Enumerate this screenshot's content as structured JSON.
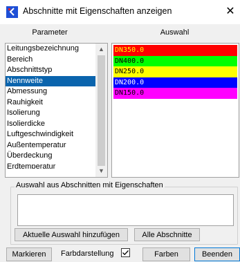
{
  "window": {
    "title": "Abschnitte mit Eigenschaften anzeigen",
    "close_glyph": "✕",
    "icon": "app-icon"
  },
  "headers": {
    "parameter": "Parameter",
    "auswahl": "Auswahl"
  },
  "parameters": {
    "items": [
      "Leitungsbezeichnung",
      "Bereich",
      "Abschnittstyp",
      "Nennweite",
      "Abmessung",
      "Rauhigkeit",
      "Isolierung",
      "Isolierdicke",
      "Luftgeschwindigkeit",
      "Außentemperatur",
      "Überdeckung",
      "Erdtemperatur"
    ],
    "selected": "Nennweite"
  },
  "auswahl": {
    "items": [
      {
        "label": "DN350.0",
        "color": "#ff0000",
        "text_color": "#ffff00"
      },
      {
        "label": "DN400.0",
        "color": "#00ff00",
        "text_color": "#000000"
      },
      {
        "label": "DN250.0",
        "color": "#ffff00",
        "text_color": "#000000"
      },
      {
        "label": "DN200.0",
        "color": "#0000ff",
        "text_color": "#ffffff"
      },
      {
        "label": "DN150.0",
        "color": "#ff00ff",
        "text_color": "#000000"
      }
    ]
  },
  "group": {
    "label": "Auswahl aus Abschnitten mit Eigenschaften",
    "add_button": "Aktuelle Auswahl hinzufügen",
    "all_button": "Alle Abschnitte"
  },
  "footer": {
    "mark_button": "Markieren",
    "farb_label": "Farbdarstellung",
    "farb_checked": true,
    "colors_button": "Farben",
    "close_button": "Beenden"
  }
}
